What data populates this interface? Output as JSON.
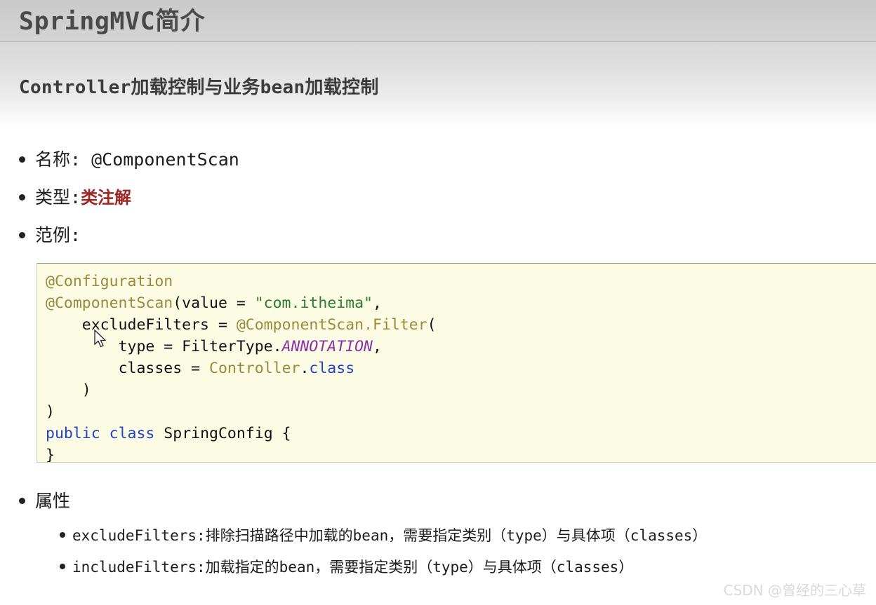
{
  "header": {
    "page_title": "SpringMVC简介",
    "section_title": "Controller加载控制与业务bean加载控制"
  },
  "bullets": {
    "name_label": "名称: @ComponentScan",
    "type_label": "类型: ",
    "type_value": "类注解",
    "example_label": "范例:",
    "attributes_label": "属性"
  },
  "code": {
    "line1_annotation": "@Configuration",
    "line2_annotation": "@ComponentScan",
    "line2_paren_open": "(value = ",
    "line2_string": "\"com.itheima\"",
    "line2_comma": ",",
    "line3_indent": "    ",
    "line3_plain": "excludeFilters = ",
    "line3_annotation": "@ComponentScan.Filter",
    "line3_paren": "(",
    "line4_indent": "        ",
    "line4_plain": "type = FilterType.",
    "line4_italic": "ANNOTATION",
    "line4_comma": ",",
    "line5_indent": "        ",
    "line5_plain": "classes = ",
    "line5_annotation": "Controller",
    "line5_dot": ".",
    "line5_keyword": "class",
    "line6": "    )",
    "line7": ")",
    "line8_kw1": "public",
    "line8_space1": " ",
    "line8_kw2": "class",
    "line8_rest": " SpringConfig {",
    "line9": "}"
  },
  "attributes": [
    {
      "name": "excludeFilters: ",
      "desc": "排除扫描路径中加载的bean，需要指定类别（type）与具体项（classes）"
    },
    {
      "name": "includeFilters: ",
      "desc": "加载指定的bean，需要指定类别（type）与具体项（classes）"
    }
  ],
  "watermark": {
    "text": "CSDN @曾经的三心草"
  },
  "colors": {
    "accent_red": "#9d2622",
    "code_bg": "#fcfce4",
    "annotation": "#9a8a3c",
    "string": "#2e7d32",
    "keyword": "#2442c8",
    "italic_const": "#8c2fa8"
  }
}
